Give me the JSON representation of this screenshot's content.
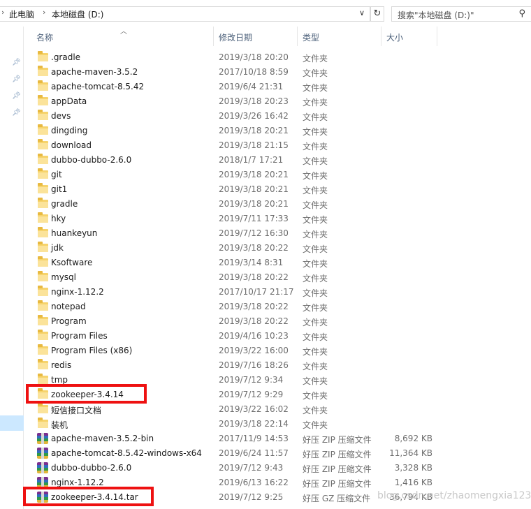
{
  "address": {
    "crumbs": [
      "此电脑",
      "本地磁盘 (D:)"
    ],
    "search_placeholder": "搜索\"本地磁盘 (D:)\""
  },
  "columns": {
    "name": "名称",
    "date": "修改日期",
    "type": "类型",
    "size": "大小"
  },
  "files": [
    {
      "name": ".gradle",
      "date": "2019/3/18 20:20",
      "type": "文件夹",
      "size": "",
      "kind": "folder"
    },
    {
      "name": "apache-maven-3.5.2",
      "date": "2017/10/18 8:59",
      "type": "文件夹",
      "size": "",
      "kind": "folder"
    },
    {
      "name": "apache-tomcat-8.5.42",
      "date": "2019/6/4 21:31",
      "type": "文件夹",
      "size": "",
      "kind": "folder"
    },
    {
      "name": "appData",
      "date": "2019/3/18 20:23",
      "type": "文件夹",
      "size": "",
      "kind": "folder"
    },
    {
      "name": "devs",
      "date": "2019/3/26 16:42",
      "type": "文件夹",
      "size": "",
      "kind": "folder"
    },
    {
      "name": "dingding",
      "date": "2019/3/18 20:21",
      "type": "文件夹",
      "size": "",
      "kind": "folder"
    },
    {
      "name": "download",
      "date": "2019/3/18 21:15",
      "type": "文件夹",
      "size": "",
      "kind": "folder"
    },
    {
      "name": "dubbo-dubbo-2.6.0",
      "date": "2018/1/7 17:21",
      "type": "文件夹",
      "size": "",
      "kind": "folder"
    },
    {
      "name": "git",
      "date": "2019/3/18 20:21",
      "type": "文件夹",
      "size": "",
      "kind": "folder"
    },
    {
      "name": "git1",
      "date": "2019/3/18 20:21",
      "type": "文件夹",
      "size": "",
      "kind": "folder"
    },
    {
      "name": "gradle",
      "date": "2019/3/18 20:21",
      "type": "文件夹",
      "size": "",
      "kind": "folder"
    },
    {
      "name": "hky",
      "date": "2019/7/11 17:33",
      "type": "文件夹",
      "size": "",
      "kind": "folder"
    },
    {
      "name": "huankeyun",
      "date": "2019/7/12 16:30",
      "type": "文件夹",
      "size": "",
      "kind": "folder"
    },
    {
      "name": "jdk",
      "date": "2019/3/18 20:22",
      "type": "文件夹",
      "size": "",
      "kind": "folder"
    },
    {
      "name": "Ksoftware",
      "date": "2019/3/14 8:31",
      "type": "文件夹",
      "size": "",
      "kind": "folder"
    },
    {
      "name": "mysql",
      "date": "2019/3/18 20:22",
      "type": "文件夹",
      "size": "",
      "kind": "folder"
    },
    {
      "name": "nginx-1.12.2",
      "date": "2017/10/17 21:17",
      "type": "文件夹",
      "size": "",
      "kind": "folder"
    },
    {
      "name": "notepad",
      "date": "2019/3/18 20:22",
      "type": "文件夹",
      "size": "",
      "kind": "folder"
    },
    {
      "name": "Program",
      "date": "2019/3/18 20:22",
      "type": "文件夹",
      "size": "",
      "kind": "folder"
    },
    {
      "name": "Program Files",
      "date": "2019/4/16 10:23",
      "type": "文件夹",
      "size": "",
      "kind": "folder"
    },
    {
      "name": "Program Files (x86)",
      "date": "2019/3/22 16:00",
      "type": "文件夹",
      "size": "",
      "kind": "folder"
    },
    {
      "name": "redis",
      "date": "2019/7/16 18:26",
      "type": "文件夹",
      "size": "",
      "kind": "folder"
    },
    {
      "name": "tmp",
      "date": "2019/7/12 9:34",
      "type": "文件夹",
      "size": "",
      "kind": "folder"
    },
    {
      "name": "zookeeper-3.4.14",
      "date": "2019/7/12 9:29",
      "type": "文件夹",
      "size": "",
      "kind": "folder",
      "highlight": true
    },
    {
      "name": "短信接口文档",
      "date": "2019/3/22 16:02",
      "type": "文件夹",
      "size": "",
      "kind": "folder"
    },
    {
      "name": "装机",
      "date": "2019/3/18 22:14",
      "type": "文件夹",
      "size": "",
      "kind": "folder"
    },
    {
      "name": "apache-maven-3.5.2-bin",
      "date": "2017/11/9 14:53",
      "type": "好压 ZIP 压缩文件",
      "size": "8,692 KB",
      "kind": "archive"
    },
    {
      "name": "apache-tomcat-8.5.42-windows-x64",
      "date": "2019/6/24 11:57",
      "type": "好压 ZIP 压缩文件",
      "size": "11,364 KB",
      "kind": "archive"
    },
    {
      "name": "dubbo-dubbo-2.6.0",
      "date": "2019/7/12 9:43",
      "type": "好压 ZIP 压缩文件",
      "size": "3,328 KB",
      "kind": "archive"
    },
    {
      "name": "nginx-1.12.2",
      "date": "2019/6/13 16:22",
      "type": "好压 ZIP 压缩文件",
      "size": "1,416 KB",
      "kind": "archive"
    },
    {
      "name": "zookeeper-3.4.14.tar",
      "date": "2019/7/12 9:25",
      "type": "好压 GZ 压缩文件",
      "size": "36,794 KB",
      "kind": "archive",
      "highlight": true
    }
  ],
  "watermark": "blog.csdn.net/zhaomengxia123",
  "colors": {
    "highlight_box": "#ee1111",
    "nav_selected": "#cce8ff",
    "folder": "#f6d36b"
  }
}
